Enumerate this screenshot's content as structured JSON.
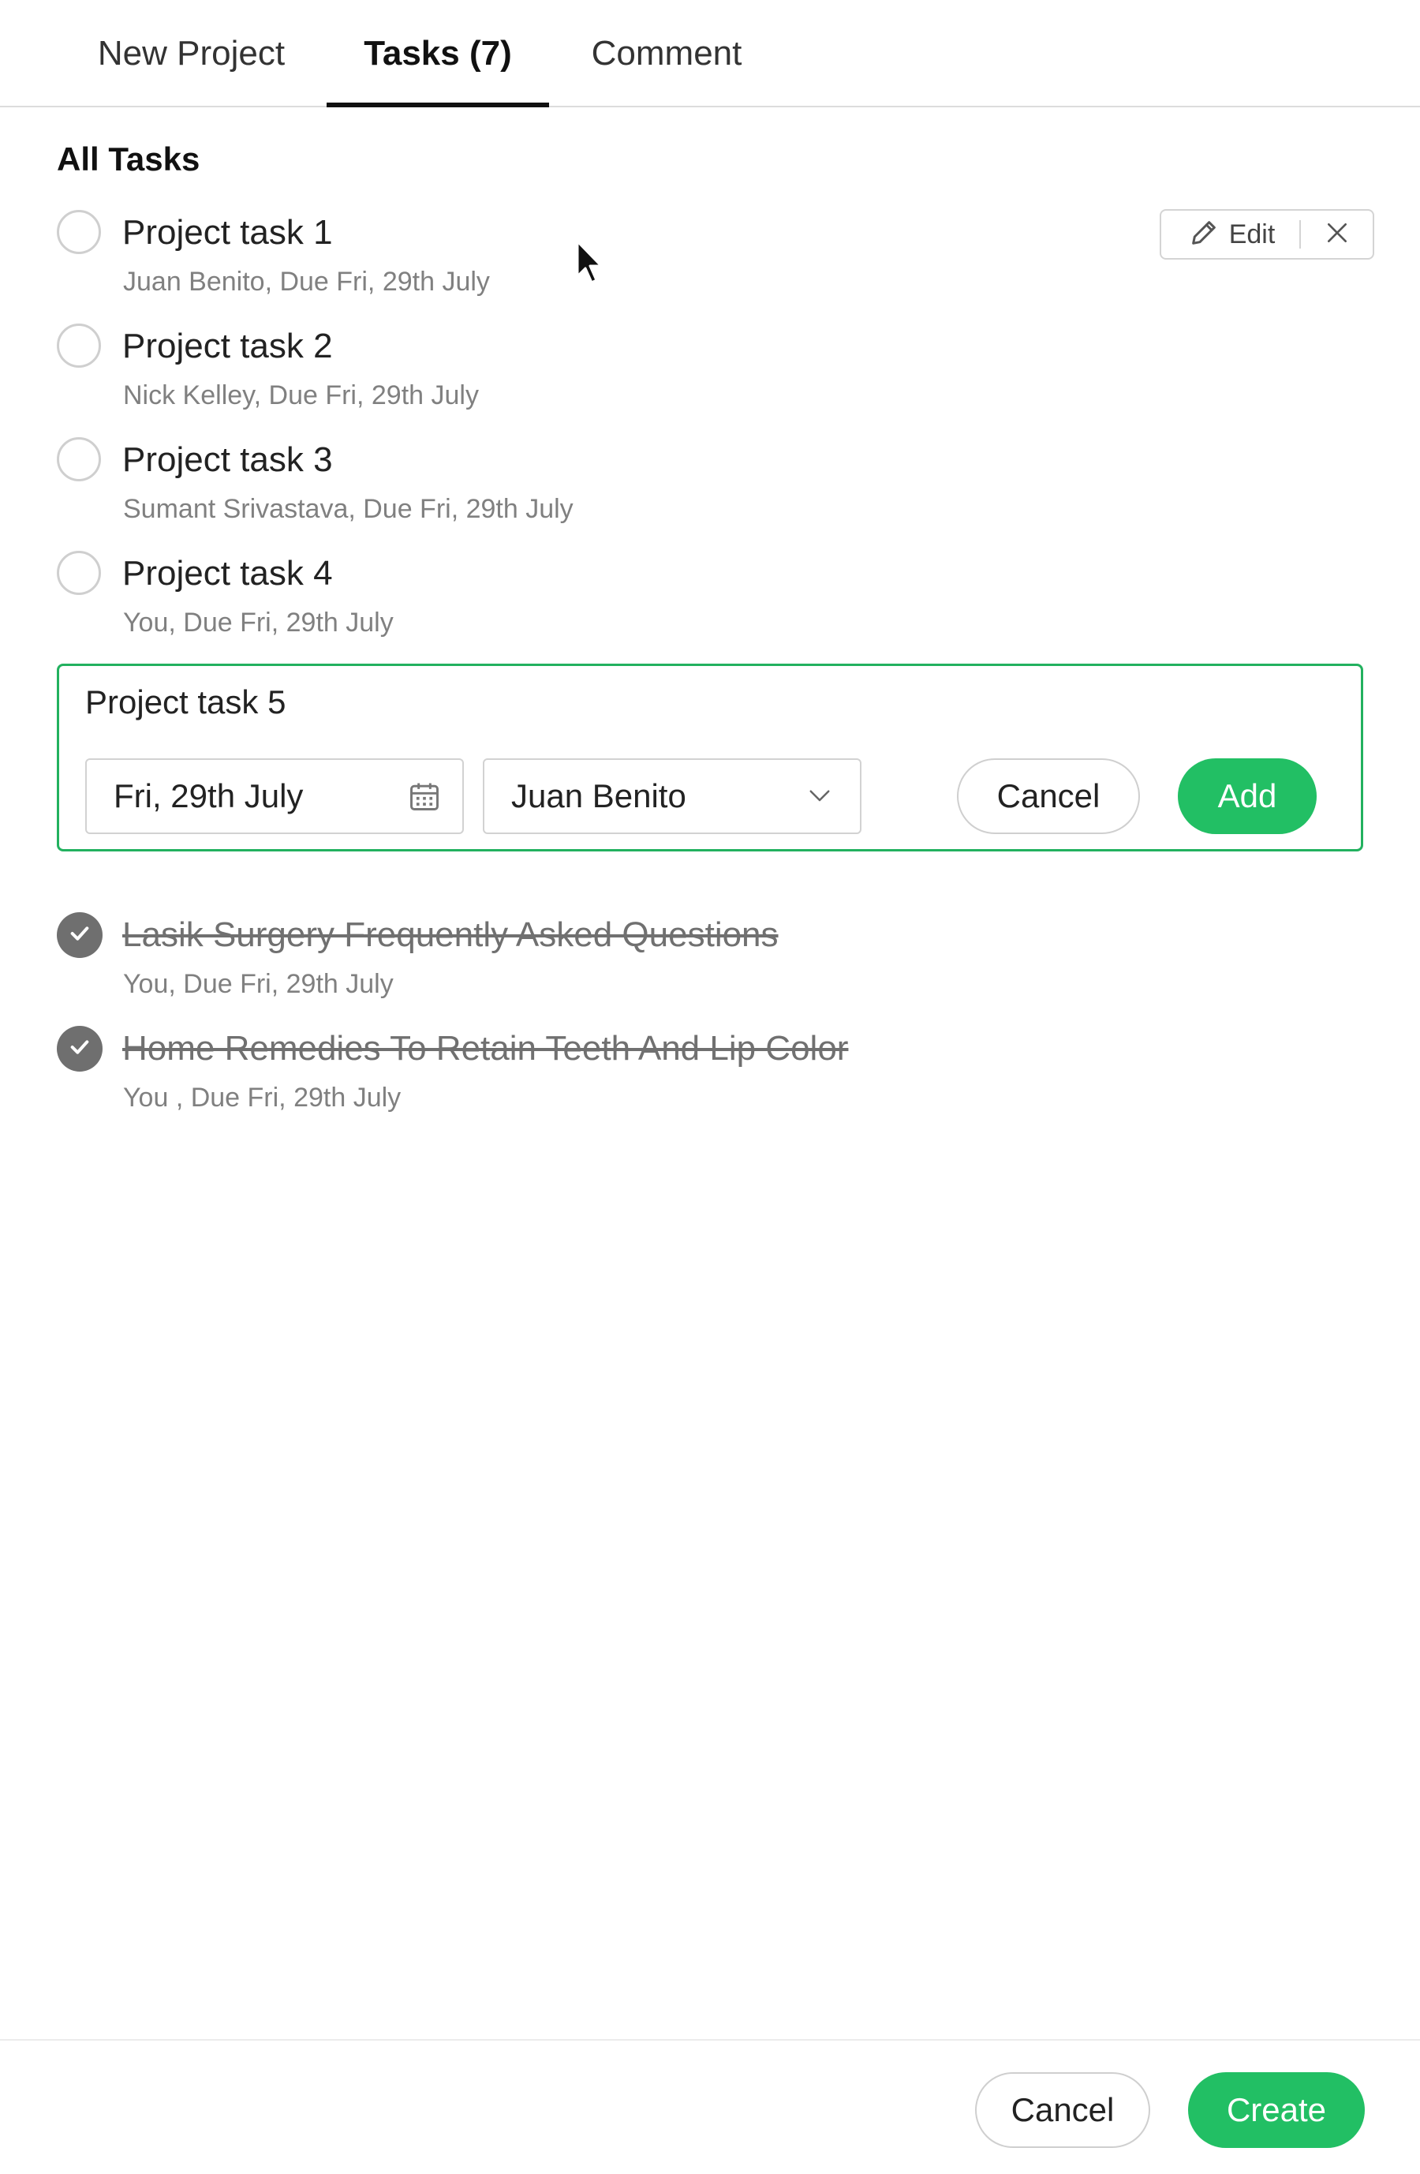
{
  "tabs": [
    {
      "label": "New Project"
    },
    {
      "label": "Tasks (7)"
    },
    {
      "label": "Comment"
    }
  ],
  "active_tab": "Tasks (7)",
  "section_title": "All Tasks",
  "tasks": [
    {
      "title": "Project task 1",
      "meta": "Juan Benito, Due Fri, 29th July"
    },
    {
      "title": "Project task 2",
      "meta": "Nick Kelley, Due Fri, 29th July"
    },
    {
      "title": "Project task 3",
      "meta": "Sumant Srivastava, Due Fri, 29th July"
    },
    {
      "title": "Project task 4",
      "meta": "You, Due Fri, 29th July"
    }
  ],
  "row_actions": {
    "edit_label": "Edit",
    "edit_icon": "pencil-icon",
    "close_icon": "close-icon"
  },
  "new_task": {
    "name": "Project task 5",
    "date": "Fri, 29th July",
    "date_icon": "calendar-icon",
    "assignee": "Juan Benito",
    "assignee_icon": "chevron-down-icon",
    "cancel_label": "Cancel",
    "add_label": "Add"
  },
  "completed_tasks": [
    {
      "title": "Lasik Surgery Frequently Asked Questions",
      "meta": "You, Due Fri, 29th July"
    },
    {
      "title": "Home Remedies To Retain Teeth And Lip Color",
      "meta": "You , Due Fri, 29th July"
    }
  ],
  "footer": {
    "cancel_label": "Cancel",
    "create_label": "Create"
  },
  "colors": {
    "accent_green": "#22bf64",
    "border_green": "#22b15f",
    "checked_gray": "#6f6f6f"
  }
}
